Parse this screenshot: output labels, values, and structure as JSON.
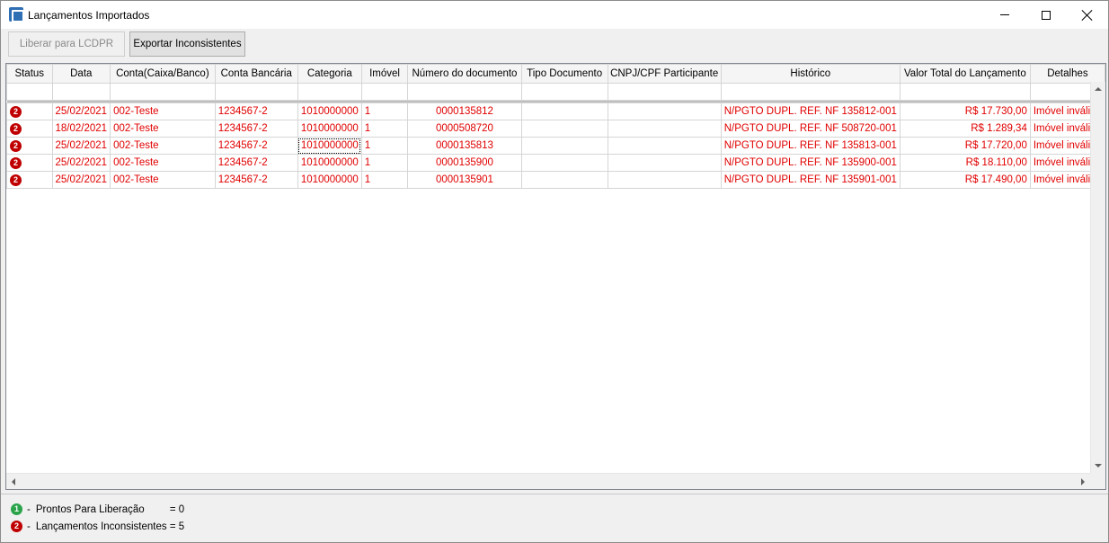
{
  "window": {
    "title": "Lançamentos Importados"
  },
  "toolbar": {
    "liberar_label": "Liberar para LCDPR",
    "exportar_label": "Exportar Inconsistentes"
  },
  "table": {
    "columns": [
      "Status",
      "Data",
      "Conta(Caixa/Banco)",
      "Conta Bancária",
      "Categoria",
      "Imóvel",
      "Número do documento",
      "Tipo Documento",
      "CNPJ/CPF Participante",
      "Histórico",
      "Valor Total do Lançamento",
      "Detalhes"
    ],
    "rows": [
      {
        "status": "2",
        "data": "25/02/2021",
        "conta": "002-Teste",
        "conta_bancaria": "1234567-2",
        "categoria": "1010000000",
        "imovel": "1",
        "numero": "0000135812",
        "tipo": "",
        "cnpj": "",
        "historico": "N/PGTO DUPL. REF. NF 135812-001",
        "valor": "R$ 17.730,00",
        "detalhes": "Imóvel inválido"
      },
      {
        "status": "2",
        "data": "18/02/2021",
        "conta": "002-Teste",
        "conta_bancaria": "1234567-2",
        "categoria": "1010000000",
        "imovel": "1",
        "numero": "0000508720",
        "tipo": "",
        "cnpj": "",
        "historico": "N/PGTO DUPL. REF. NF 508720-001",
        "valor": "R$ 1.289,34",
        "detalhes": "Imóvel inválido"
      },
      {
        "status": "2",
        "data": "25/02/2021",
        "conta": "002-Teste",
        "conta_bancaria": "1234567-2",
        "categoria": "1010000000",
        "imovel": "1",
        "numero": "0000135813",
        "tipo": "",
        "cnpj": "",
        "historico": "N/PGTO DUPL. REF. NF 135813-001",
        "valor": "R$ 17.720,00",
        "detalhes": "Imóvel inválido"
      },
      {
        "status": "2",
        "data": "25/02/2021",
        "conta": "002-Teste",
        "conta_bancaria": "1234567-2",
        "categoria": "1010000000",
        "imovel": "1",
        "numero": "0000135900",
        "tipo": "",
        "cnpj": "",
        "historico": "N/PGTO DUPL. REF. NF 135900-001",
        "valor": "R$ 18.110,00",
        "detalhes": "Imóvel inválido"
      },
      {
        "status": "2",
        "data": "25/02/2021",
        "conta": "002-Teste",
        "conta_bancaria": "1234567-2",
        "categoria": "1010000000",
        "imovel": "1",
        "numero": "0000135901",
        "tipo": "",
        "cnpj": "",
        "historico": "N/PGTO DUPL. REF. NF 135901-001",
        "valor": "R$ 17.490,00",
        "detalhes": "Imóvel inválido"
      }
    ]
  },
  "legend": {
    "ready": {
      "badge": "1",
      "dash": "-",
      "label": "Prontos Para Liberação",
      "value": "= 0"
    },
    "inconsistent": {
      "badge": "2",
      "dash": "-",
      "label": "Lançamentos Inconsistentes",
      "value": "= 5"
    }
  },
  "colors": {
    "error_text": "#e00000",
    "badge_red": "#c00000",
    "badge_green": "#2aa34a"
  }
}
